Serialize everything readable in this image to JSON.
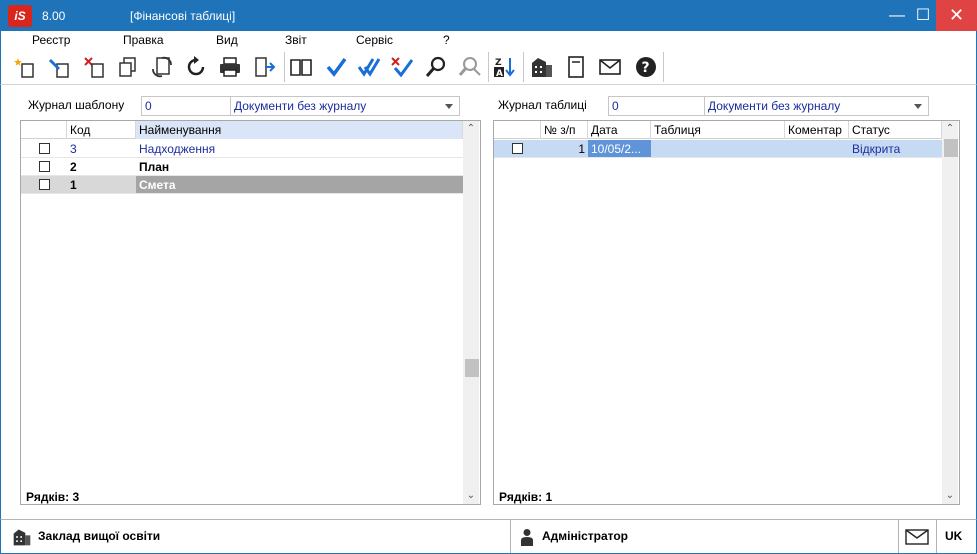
{
  "app": {
    "version": "8.00",
    "window_title": "[Фінансові таблиці]",
    "logo_text": "iS"
  },
  "window_controls": {
    "minimize": "—",
    "maximize": "☐",
    "close": "✕"
  },
  "menu": [
    "Реєстр",
    "Правка",
    "Вид",
    "Звіт",
    "Сервіс",
    "?"
  ],
  "toolbar": [
    {
      "name": "create-icon"
    },
    {
      "name": "edit-icon"
    },
    {
      "name": "delete-icon"
    },
    {
      "name": "copy-icon"
    },
    {
      "name": "transfer-icon"
    },
    {
      "name": "refresh-icon"
    },
    {
      "name": "print-icon"
    },
    {
      "name": "export-icon"
    },
    {
      "name": "book-icon"
    },
    {
      "name": "check-icon"
    },
    {
      "name": "check-all-icon"
    },
    {
      "name": "uncheck-icon"
    },
    {
      "name": "search-icon"
    },
    {
      "name": "filter-search-icon"
    },
    {
      "name": "sort-icon"
    },
    {
      "name": "buildings-icon"
    },
    {
      "name": "document-icon"
    },
    {
      "name": "mail-icon"
    },
    {
      "name": "help-icon"
    }
  ],
  "left_panel": {
    "journal_label": "Журнал шаблону",
    "journal_code": "0",
    "journal_value": "Документи без журналу",
    "columns": [
      "Код",
      "Найменування"
    ],
    "rows": [
      {
        "code": "3",
        "name": "Надходження",
        "style": "link"
      },
      {
        "code": "2",
        "name": "План",
        "style": "bold"
      },
      {
        "code": "1",
        "name": "Смета",
        "style": "selected"
      }
    ],
    "row_count": "Рядків: 3"
  },
  "right_panel": {
    "journal_label": "Журнал таблиці",
    "journal_code": "0",
    "journal_value": "Документи без журналу",
    "columns": [
      "№ з/п",
      "Дата",
      "Таблиця",
      "Коментар",
      "Статус"
    ],
    "rows": [
      {
        "num": "1",
        "date": "10/05/2...",
        "table": "",
        "comment": "",
        "status": "Відкрита"
      }
    ],
    "row_count": "Рядків: 1"
  },
  "statusbar": {
    "organization": "Заклад вищої освіти",
    "user": "Адміністратор",
    "language": "UK"
  },
  "colors": {
    "titlebar": "#1e73b9",
    "close": "#e04343",
    "link_text": "#1c2d9c",
    "selected_row": "#a5a5a5",
    "selected_row_right": "#c7daf4",
    "header_active": "#dae6f7"
  }
}
